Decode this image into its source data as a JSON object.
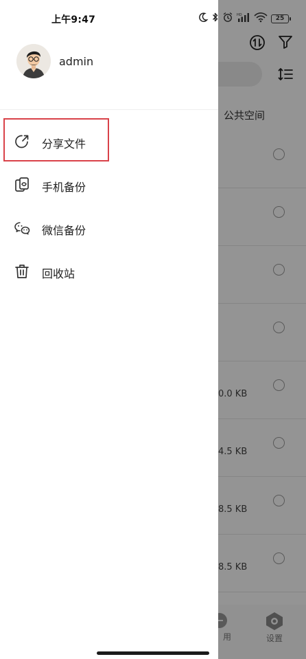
{
  "status_bar": {
    "time": "上午9:47",
    "battery": "25"
  },
  "drawer": {
    "username": "admin",
    "menu": [
      {
        "label": "分享文件",
        "icon": "share-icon"
      },
      {
        "label": "手机备份",
        "icon": "phone-backup-icon"
      },
      {
        "label": "微信备份",
        "icon": "wechat-icon"
      },
      {
        "label": "回收站",
        "icon": "trash-icon"
      }
    ],
    "highlighted_item": "分享文件"
  },
  "background_app": {
    "tab_label": "公共空间",
    "file_sizes": [
      "0.0 KB",
      "4.5 KB",
      "8.5 KB",
      "8.5 KB"
    ],
    "nav": {
      "apps_label": "用",
      "settings_label": "设置"
    }
  },
  "colors": {
    "highlight_border": "#d94148",
    "scrim": "rgba(0,0,0,0.42)"
  }
}
